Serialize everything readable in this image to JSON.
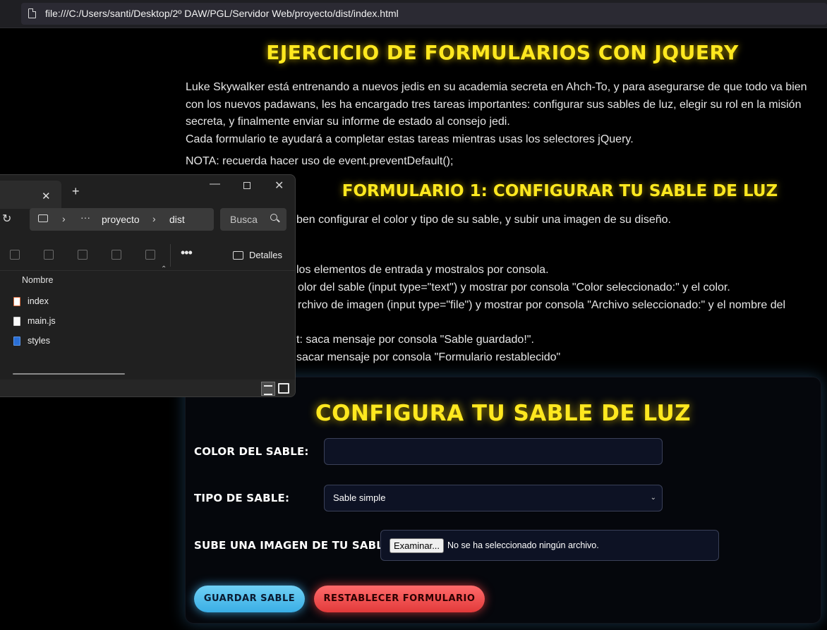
{
  "browser": {
    "url": "file:///C:/Users/santi/Desktop/2º DAW/PGL/Servidor Web/proyecto/dist/index.html"
  },
  "page": {
    "title": "EJERCICIO DE FORMULARIOS CON JQUERY",
    "intro_lines": [
      "Luke Skywalker está entrenando a nuevos jedis en su academia secreta en Ahch-To, y para asegurarse de que todo va bien",
      "con los nuevos padawans, les ha encargado tres tareas importantes: configurar sus sables de luz, elegir su rol en la misión",
      "secreta, y finalmente enviar su informe de estado al consejo jedi.",
      "Cada formulario te ayudará a completar estas tareas mientras usas los selectores jQuery."
    ],
    "nota": "NOTA: recuerda hacer uso de event.preventDefault();",
    "section1": {
      "heading": "FORMULARIO 1: CONFIGURAR TU SABLE DE LUZ",
      "description": "ben configurar el color y tipo de su sable, y subir una imagen de su diseño.",
      "tasks": [
        "los elementos de entrada y mostralos por consola.",
        "olor del sable (input type=\"text\") y mostrar por consola \"Color seleccionado:\" y el color.",
        "rchivo de imagen (input type=\"file\") y mostrar por consola \"Archivo seleccionado:\" y el nombre del",
        "t: saca mensaje por consola \"Sable guardado!\".",
        "sacar mensaje por consola \"Formulario restablecido\""
      ]
    }
  },
  "form": {
    "title": "CONFIGURA TU SABLE DE LUZ",
    "color_label": "COLOR DEL SABLE:",
    "color_value": "",
    "tipo_label": "TIPO DE SABLE:",
    "tipo_selected": "Sable simple",
    "imagen_label": "SUBE UNA IMAGEN DE TU SABLE:",
    "file_button": "Examinar...",
    "file_status": "No se ha seleccionado ningún archivo.",
    "save_button": "GUARDAR SABLE",
    "reset_button": "RESTABLECER FORMULARIO",
    "colors": {
      "accent_yellow": "#ffe81f",
      "save_blue": "#4cbcec",
      "reset_red": "#f04848"
    }
  },
  "explorer": {
    "breadcrumbs": [
      "proyecto",
      "dist"
    ],
    "search_placeholder": "Busca",
    "details_label": "Detalles",
    "column_name": "Nombre",
    "files": [
      {
        "name": "index",
        "icon": "html-file-icon"
      },
      {
        "name": "main.js",
        "icon": "js-file-icon"
      },
      {
        "name": "styles",
        "icon": "css-file-icon"
      }
    ]
  }
}
